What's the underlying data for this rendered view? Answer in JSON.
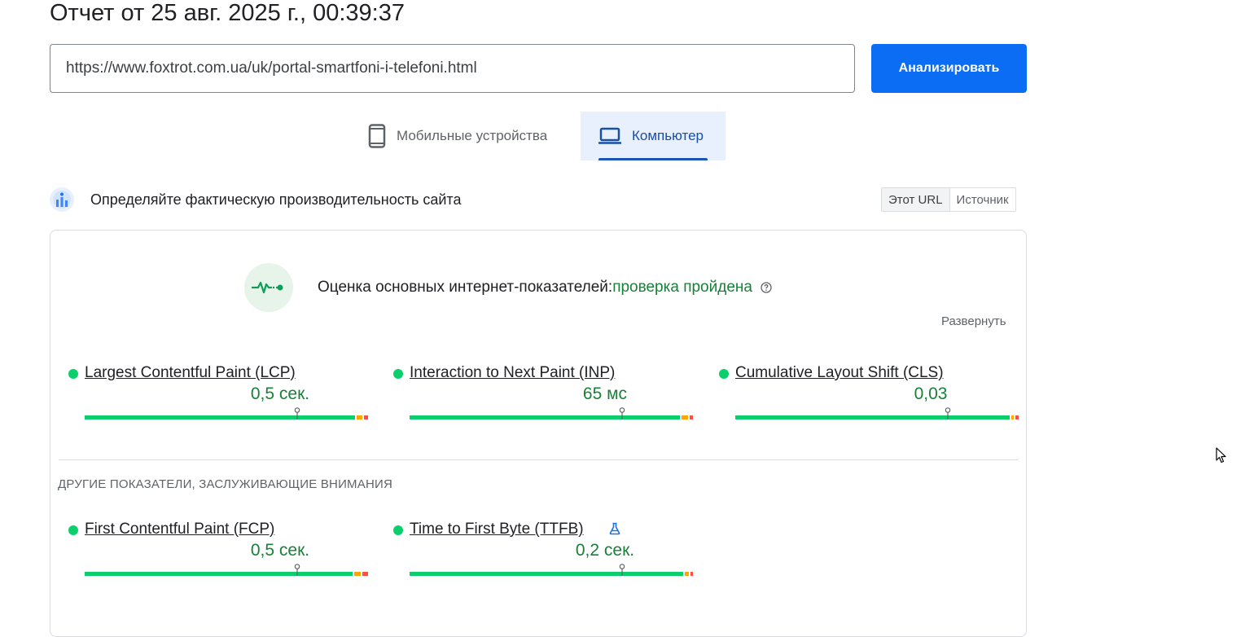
{
  "header": {
    "title": "Отчет от 25 авг. 2025 г., 00:39:37"
  },
  "search": {
    "value": "https://www.foxtrot.com.ua/uk/portal-smartfoni-i-telefoni.html",
    "button_label": "Анализировать"
  },
  "tabs": [
    {
      "label": "Мобильные устройства",
      "icon": "smartphone-icon",
      "selected": false
    },
    {
      "label": "Компьютер",
      "icon": "laptop-icon",
      "selected": true
    }
  ],
  "section": {
    "heading": "Определяйте фактическую производительность сайта",
    "toggle": [
      "Этот URL",
      "Источник"
    ]
  },
  "assessment": {
    "label": "Оценка основных интернет-показателей:",
    "result": "проверка пройдена",
    "expand_label": "Развернуть"
  },
  "core_metrics": [
    {
      "name": "Largest Contentful Paint (LCP)",
      "value": "0,5 сек.",
      "status": "good",
      "good_fraction": 0.96,
      "needs_improvement_fraction": 0.025,
      "poor_fraction": 0.015,
      "percentile_position": 0.75
    },
    {
      "name": "Interaction to Next Paint (INP)",
      "value": "65 мс",
      "status": "good",
      "good_fraction": 0.96,
      "needs_improvement_fraction": 0.03,
      "poor_fraction": 0.01,
      "percentile_position": 0.75
    },
    {
      "name": "Cumulative Layout Shift (CLS)",
      "value": "0,03",
      "status": "good",
      "good_fraction": 0.975,
      "needs_improvement_fraction": 0.015,
      "poor_fraction": 0.01,
      "percentile_position": 0.75
    }
  ],
  "other_section": {
    "heading": "ДРУГИЕ ПОКАЗАТЕЛИ, ЗАСЛУЖИВАЮЩИЕ ВНИМАНИЯ"
  },
  "other_metrics": [
    {
      "name": "First Contentful Paint (FCP)",
      "value": "0,5 сек.",
      "status": "good",
      "experimental": false,
      "good_fraction": 0.95,
      "needs_improvement_fraction": 0.03,
      "poor_fraction": 0.02,
      "percentile_position": 0.75
    },
    {
      "name": "Time to First Byte (TTFB)",
      "value": "0,2 сек.",
      "status": "good",
      "experimental": true,
      "good_fraction": 0.97,
      "needs_improvement_fraction": 0.02,
      "poor_fraction": 0.01,
      "percentile_position": 0.75
    }
  ],
  "colors": {
    "good": "#0cce6b",
    "needs_improvement": "#ffa400",
    "poor": "#ff4e42",
    "accent": "#0b6cf4",
    "pass_text": "#188038"
  }
}
